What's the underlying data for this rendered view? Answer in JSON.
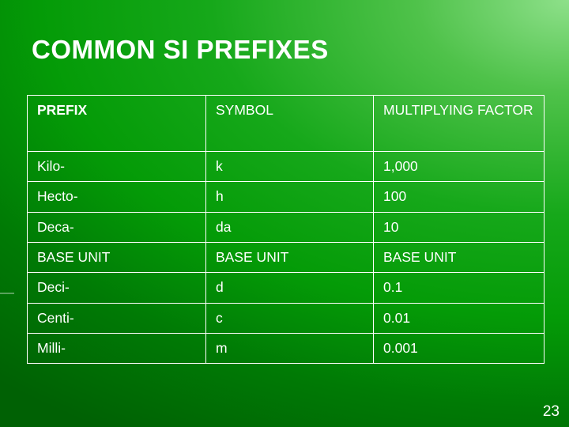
{
  "slide": {
    "title": "COMMON SI PREFIXES",
    "page_number": "23"
  },
  "table": {
    "headers": [
      "PREFIX",
      "SYMBOL",
      "MULTIPLYING FACTOR"
    ],
    "rows": [
      [
        "Kilo-",
        "k",
        "1,000"
      ],
      [
        "Hecto-",
        "h",
        "100"
      ],
      [
        "Deca-",
        "da",
        "10"
      ],
      [
        "BASE UNIT",
        "BASE UNIT",
        "BASE UNIT"
      ],
      [
        "Deci-",
        "d",
        "0.1"
      ],
      [
        "Centi-",
        "c",
        "0.01"
      ],
      [
        "Milli-",
        "m",
        "0.001"
      ]
    ]
  }
}
